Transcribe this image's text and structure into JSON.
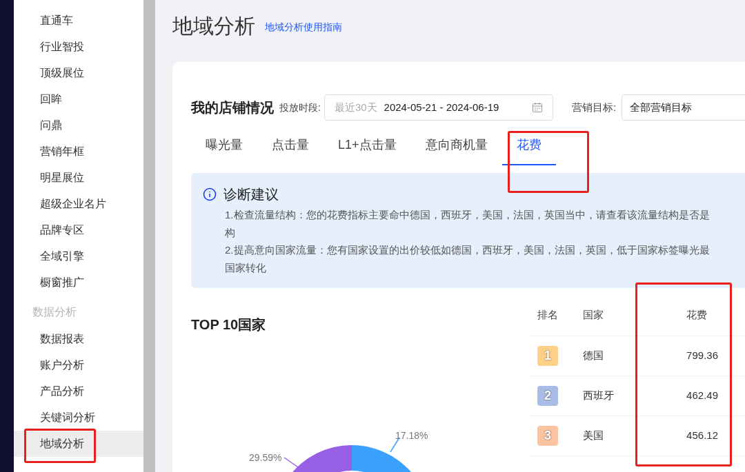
{
  "sidebar": {
    "items": [
      {
        "label": "直通车",
        "selected": false
      },
      {
        "label": "行业智投",
        "selected": false
      },
      {
        "label": "顶级展位",
        "selected": false
      },
      {
        "label": "回眸",
        "selected": false
      },
      {
        "label": "问鼎",
        "selected": false
      },
      {
        "label": "营销年框",
        "selected": false
      },
      {
        "label": "明星展位",
        "selected": false
      },
      {
        "label": "超级企业名片",
        "selected": false
      },
      {
        "label": "品牌专区",
        "selected": false
      },
      {
        "label": "全域引擎",
        "selected": false
      },
      {
        "label": "橱窗推广",
        "selected": false
      }
    ],
    "group": {
      "title": "数据分析",
      "items": [
        {
          "label": "数据报表",
          "selected": false
        },
        {
          "label": "账户分析",
          "selected": false
        },
        {
          "label": "产品分析",
          "selected": false
        },
        {
          "label": "关键词分析",
          "selected": false
        },
        {
          "label": "地域分析",
          "selected": true
        }
      ]
    }
  },
  "page": {
    "title": "地域分析",
    "guide_link": "地域分析使用指南"
  },
  "store": {
    "title": "我的店铺情况",
    "period_label": "投放时段:",
    "period_preset": "最近30天",
    "period_value": "2024-05-21 - 2024-06-19",
    "goal_label": "营销目标:",
    "goal_value": "全部营销目标"
  },
  "tabs": [
    {
      "label": "曝光量",
      "selected": false
    },
    {
      "label": "点击量",
      "selected": false
    },
    {
      "label": "L1+点击量",
      "selected": false
    },
    {
      "label": "意向商机量",
      "selected": false
    },
    {
      "label": "花费",
      "selected": true
    }
  ],
  "advice": {
    "title": "诊断建议",
    "items": [
      {
        "lines": [
          "1.检查流量结构：您的花费指标主要命中德国，西班牙，美国，法国，英国当中，请查看该流量结构是否是",
          "构"
        ]
      },
      {
        "lines": [
          "2.提高意向国家流量：您有国家设置的出价较低如德国，西班牙，美国，法国，英国，低于国家标签曝光最",
          "国家转化"
        ]
      }
    ]
  },
  "top10": {
    "title": "TOP 10国家",
    "slice_labels": [
      {
        "text": "17.18%",
        "color": "#3ba1ff"
      },
      {
        "text": "29.59%",
        "color": "#975fe4"
      }
    ]
  },
  "table": {
    "columns": [
      "排名",
      "国家",
      "花费"
    ],
    "rows": [
      {
        "rank": "1",
        "country": "德国",
        "cost": "799.36",
        "color": "#fdd08a"
      },
      {
        "rank": "2",
        "country": "西班牙",
        "cost": "462.49",
        "color": "#a9bce6"
      },
      {
        "rank": "3",
        "country": "美国",
        "cost": "456.12",
        "color": "#fbc4a0"
      }
    ]
  }
}
